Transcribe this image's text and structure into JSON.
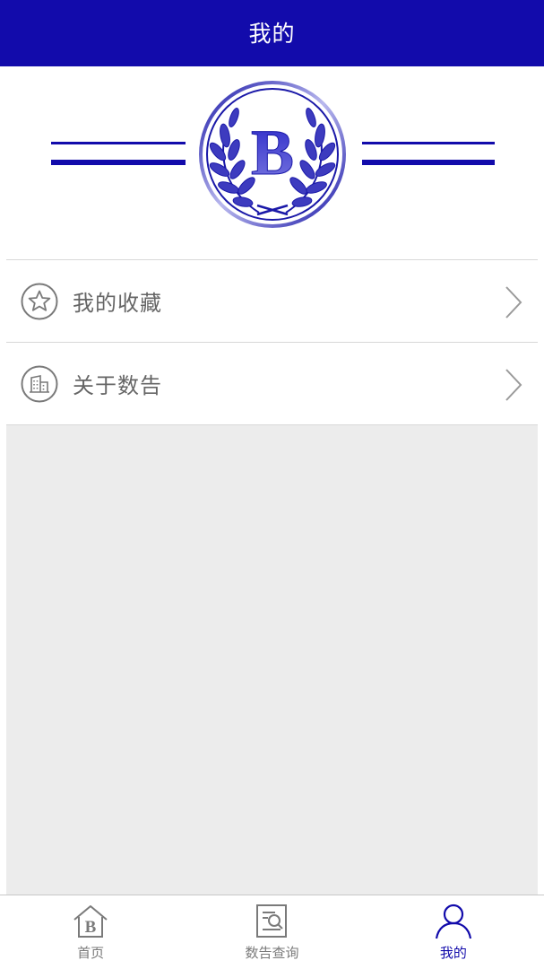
{
  "header": {
    "title": "我的"
  },
  "hero": {
    "logo_letter": "B"
  },
  "menu": {
    "items": [
      {
        "label": "我的收藏",
        "icon": "star-circle-icon"
      },
      {
        "label": "关于数告",
        "icon": "building-circle-icon"
      }
    ]
  },
  "tabbar": {
    "tabs": [
      {
        "label": "首页",
        "icon": "home-b-icon",
        "active": false
      },
      {
        "label": "数告查询",
        "icon": "search-document-icon",
        "active": false
      },
      {
        "label": "我的",
        "icon": "user-icon",
        "active": true
      }
    ]
  },
  "colors": {
    "brand": "#120bab",
    "inactive": "#7a7a7a",
    "background": "#ececec"
  }
}
